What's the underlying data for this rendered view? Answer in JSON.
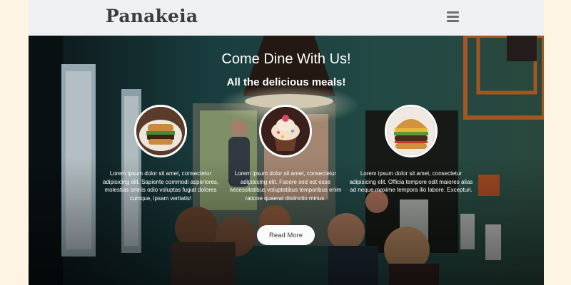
{
  "header": {
    "brand": "Panakeia",
    "menu_icon": "hamburger-menu-icon"
  },
  "hero": {
    "title": "Come Dine With Us!",
    "subtitle": "All the delicious meals!"
  },
  "features": [
    {
      "image_icon": "burger-plate-photo",
      "text": "Lorem ipsum dolor sit amet, consectetur adipisicing elit. Sapiente commodi asperiores, molestias omnis odio voluptas fugiat dolores cumque, ipsam veritatis!"
    },
    {
      "image_icon": "cupcake-photo",
      "text": "Lorem ipsum dolor sit amet, consectetur adipisicing elit. Facere sed est esse necessitatibus voluptatibus temporibus enim ratione quaerat distinctio minus."
    },
    {
      "image_icon": "burger-photo",
      "text": "Lorem ipsum dolor sit amet, consectetur adipisicing elit. Officia tempore odit maiores alias ad neque maxime tempora illo labore. Excepturi."
    }
  ],
  "cta": {
    "label": "Read More"
  },
  "colors": {
    "page_background": "#fdf4e3",
    "navbar": "#eef0f2",
    "brand_text": "#3a3d41",
    "button": "#fbfbfb"
  }
}
